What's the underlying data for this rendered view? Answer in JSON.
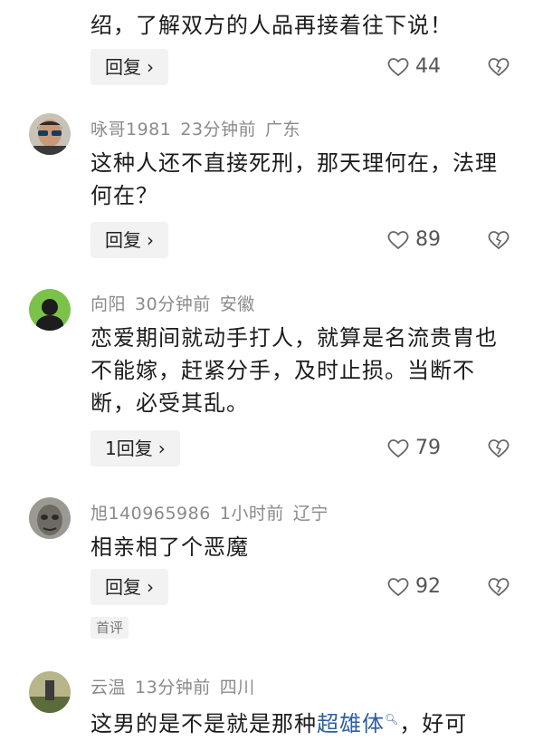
{
  "comments": [
    {
      "text_line2": "绍，了解双方的人品再接着往下说！",
      "reply": "回复",
      "likes": "44"
    },
    {
      "user": "咏哥1981",
      "time": "23分钟前",
      "location": "广东",
      "text": "这种人还不直接死刑，那天理何在，法理何在？",
      "reply": "回复",
      "likes": "89"
    },
    {
      "user": "向阳",
      "time": "30分钟前",
      "location": "安徽",
      "text": "恋爱期间就动手打人，就算是名流贵胄也不能嫁，赶紧分手，及时止损。当断不断，必受其乱。",
      "reply": "1回复",
      "likes": "79"
    },
    {
      "user": "旭140965986",
      "time": "1小时前",
      "location": "辽宁",
      "text": "相亲相了个恶魔",
      "reply": "回复",
      "likes": "92",
      "badge": "首评"
    },
    {
      "user": "云温",
      "time": "13分钟前",
      "location": "四川",
      "text_before": "这男的是不是就是那种",
      "text_link": "超雄体",
      "text_after": "，好可"
    }
  ],
  "icons": {
    "like": "heart-outline-icon",
    "dislike": "broken-heart-icon",
    "chevron": "chevron-right-icon",
    "search": "search-icon"
  }
}
